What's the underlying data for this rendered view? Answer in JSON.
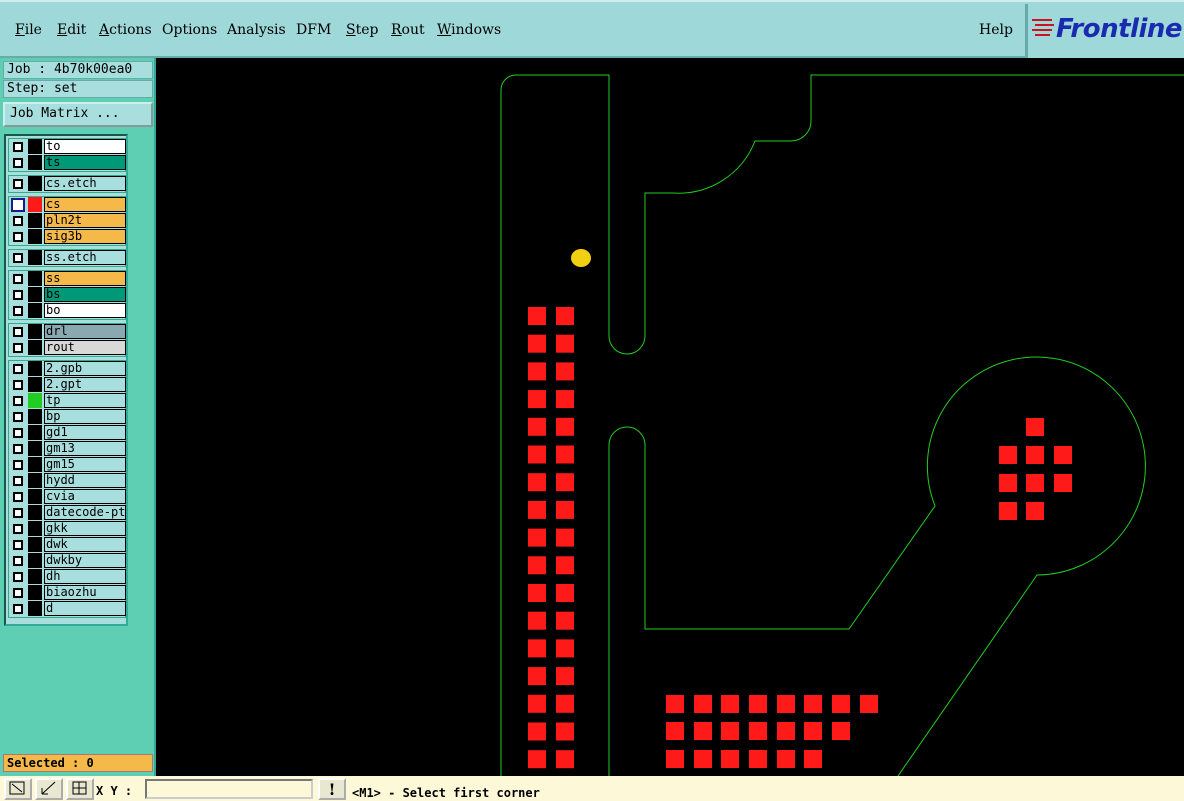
{
  "menu": {
    "items": [
      "File",
      "Edit",
      "Actions",
      "Options",
      "Analysis",
      "DFM",
      "Step",
      "Rout",
      "Windows"
    ],
    "help": "Help"
  },
  "logo": {
    "text": "Frontline"
  },
  "job": {
    "line": "Job : 4b70k00ea0",
    "step": "Step: set",
    "matrix_button": "Job Matrix ..."
  },
  "layers": [
    {
      "name": "to",
      "color": "#ffffff"
    },
    {
      "name": "ts",
      "color": "#009977"
    },
    {
      "name": "cs.etch",
      "color": "#a8dede"
    },
    {
      "name": "cs",
      "color": "#f5b94a",
      "swatch": "#ff1a1a",
      "active": true
    },
    {
      "name": "pln2t",
      "color": "#f5b94a"
    },
    {
      "name": "sig3b",
      "color": "#f5b94a"
    },
    {
      "name": "ss.etch",
      "color": "#a8dede"
    },
    {
      "name": "ss",
      "color": "#f5b94a"
    },
    {
      "name": "bs",
      "color": "#009977"
    },
    {
      "name": "bo",
      "color": "#ffffff"
    },
    {
      "name": "drl",
      "color": "#8aa8b0"
    },
    {
      "name": "rout",
      "color": "#d8d8d8"
    },
    {
      "name": "2.gpb",
      "color": "#a8dede"
    },
    {
      "name": "2.gpt",
      "color": "#a8dede"
    },
    {
      "name": "tp",
      "color": "#a8dede",
      "swatch": "#22cc22"
    },
    {
      "name": "bp",
      "color": "#a8dede"
    },
    {
      "name": "gd1",
      "color": "#a8dede"
    },
    {
      "name": "gm13",
      "color": "#a8dede"
    },
    {
      "name": "gm15",
      "color": "#a8dede"
    },
    {
      "name": "hydd",
      "color": "#a8dede"
    },
    {
      "name": "cvia",
      "color": "#a8dede"
    },
    {
      "name": "datecode-ptd",
      "color": "#a8dede"
    },
    {
      "name": "gkk",
      "color": "#a8dede"
    },
    {
      "name": "dwk",
      "color": "#a8dede"
    },
    {
      "name": "dwkby",
      "color": "#a8dede"
    },
    {
      "name": "dh",
      "color": "#a8dede"
    },
    {
      "name": "biaozhu",
      "color": "#a8dede"
    },
    {
      "name": "d",
      "color": "#a8dede"
    }
  ],
  "selected": "Selected : 0",
  "status": {
    "xy_label": "X Y :",
    "xy_value": "",
    "warn": "!",
    "message": "<M1> - Select first corner"
  },
  "colors": {
    "outline": "#22cc22",
    "pad": "#ff1a1a",
    "marker": "#f0d010"
  }
}
